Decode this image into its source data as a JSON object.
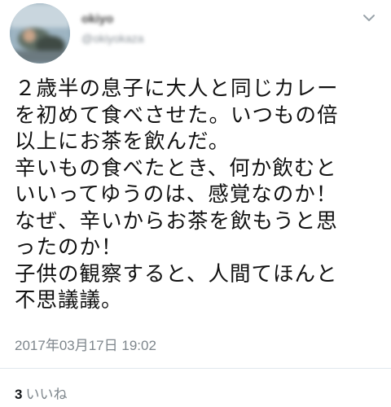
{
  "user": {
    "display_name": "okiyo",
    "handle": "@okiyokaza"
  },
  "tweet": {
    "text": "２歳半の息子に大人と同じカレー\nを初めて食べさせた。いつもの倍\n以上にお茶を飲んだ。\n辛いもの食べたとき、何か飲むと\nいいってゆうのは、感覚なのか！\nなぜ、辛いからお茶を飲もうと思\nったのか！\n子供の観察すると、人間てほんと\n不思議議。",
    "timestamp": "2017年03月17日 19:02"
  },
  "stats": {
    "likes_count": "3",
    "likes_label": "いいね"
  },
  "icons": {
    "menu": "chevron-down-icon",
    "avatar": "avatar"
  },
  "colors": {
    "text": "#111111",
    "muted": "#7e868c",
    "divider": "#e1e8ed"
  }
}
